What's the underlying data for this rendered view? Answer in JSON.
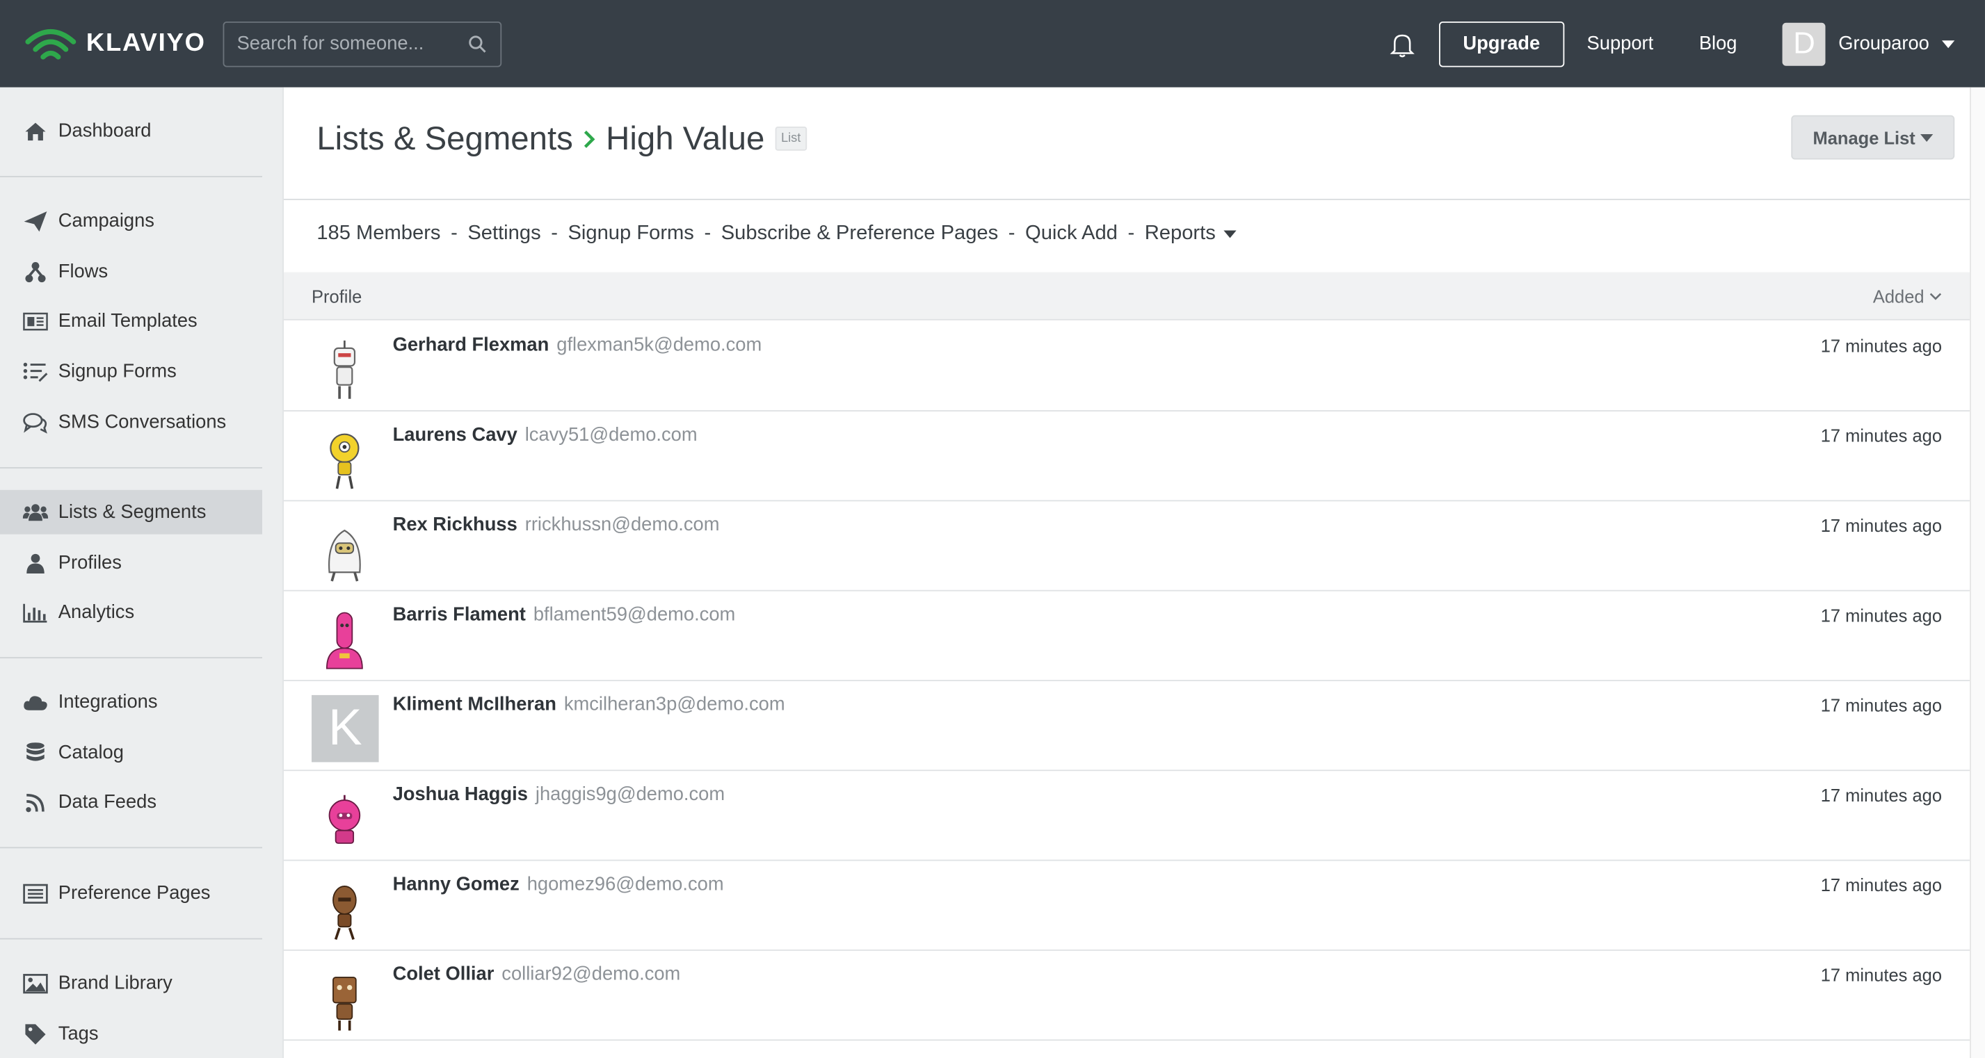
{
  "brand": {
    "name": "KLAVIYO",
    "accent": "#2ea84b"
  },
  "topnav": {
    "search_placeholder": "Search for someone...",
    "upgrade_label": "Upgrade",
    "support_label": "Support",
    "blog_label": "Blog",
    "account_initial": "D",
    "account_name": "Grouparoo"
  },
  "sidebar": {
    "groups": [
      [
        {
          "label": "Dashboard",
          "icon": "home-icon"
        }
      ],
      [
        {
          "label": "Campaigns",
          "icon": "paper-plane-icon"
        },
        {
          "label": "Flows",
          "icon": "flow-icon"
        },
        {
          "label": "Email Templates",
          "icon": "template-icon"
        },
        {
          "label": "Signup Forms",
          "icon": "form-list-icon"
        },
        {
          "label": "SMS Conversations",
          "icon": "chat-icon"
        }
      ],
      [
        {
          "label": "Lists & Segments",
          "icon": "users-icon",
          "active": true
        },
        {
          "label": "Profiles",
          "icon": "user-icon"
        },
        {
          "label": "Analytics",
          "icon": "bar-chart-icon"
        }
      ],
      [
        {
          "label": "Integrations",
          "icon": "cloud-icon"
        },
        {
          "label": "Catalog",
          "icon": "database-icon"
        },
        {
          "label": "Data Feeds",
          "icon": "rss-icon"
        }
      ],
      [
        {
          "label": "Preference Pages",
          "icon": "list-page-icon"
        }
      ],
      [
        {
          "label": "Brand Library",
          "icon": "image-icon"
        },
        {
          "label": "Tags",
          "icon": "tag-icon"
        }
      ]
    ]
  },
  "page": {
    "breadcrumb_parent": "Lists & Segments",
    "title": "High Value",
    "type_tag": "List",
    "manage_label": "Manage List"
  },
  "subnav": {
    "members": "185 Members",
    "settings": "Settings",
    "signup_forms": "Signup Forms",
    "subscribe_pages": "Subscribe & Preference Pages",
    "quick_add": "Quick Add",
    "reports": "Reports",
    "separator": "-"
  },
  "table": {
    "col_profile": "Profile",
    "col_added": "Added",
    "rows": [
      {
        "name": "Gerhard Flexman",
        "email": "gflexman5k@demo.com",
        "added": "17 minutes ago",
        "avatar": "robot-white"
      },
      {
        "name": "Laurens Cavy",
        "email": "lcavy51@demo.com",
        "added": "17 minutes ago",
        "avatar": "robot-yellow"
      },
      {
        "name": "Rex Rickhuss",
        "email": "rrickhussn@demo.com",
        "added": "17 minutes ago",
        "avatar": "robot-ghost"
      },
      {
        "name": "Barris Flament",
        "email": "bflament59@demo.com",
        "added": "17 minutes ago",
        "avatar": "robot-pink"
      },
      {
        "name": "Kliment McIlheran",
        "email": "kmcilheran3p@demo.com",
        "added": "17 minutes ago",
        "avatar": "letter",
        "initial": "K"
      },
      {
        "name": "Joshua Haggis",
        "email": "jhaggis9g@demo.com",
        "added": "17 minutes ago",
        "avatar": "robot-pink-round"
      },
      {
        "name": "Hanny Gomez",
        "email": "hgomez96@demo.com",
        "added": "17 minutes ago",
        "avatar": "robot-brown"
      },
      {
        "name": "Colet Olliar",
        "email": "colliar92@demo.com",
        "added": "17 minutes ago",
        "avatar": "robot-brown-box"
      }
    ]
  }
}
